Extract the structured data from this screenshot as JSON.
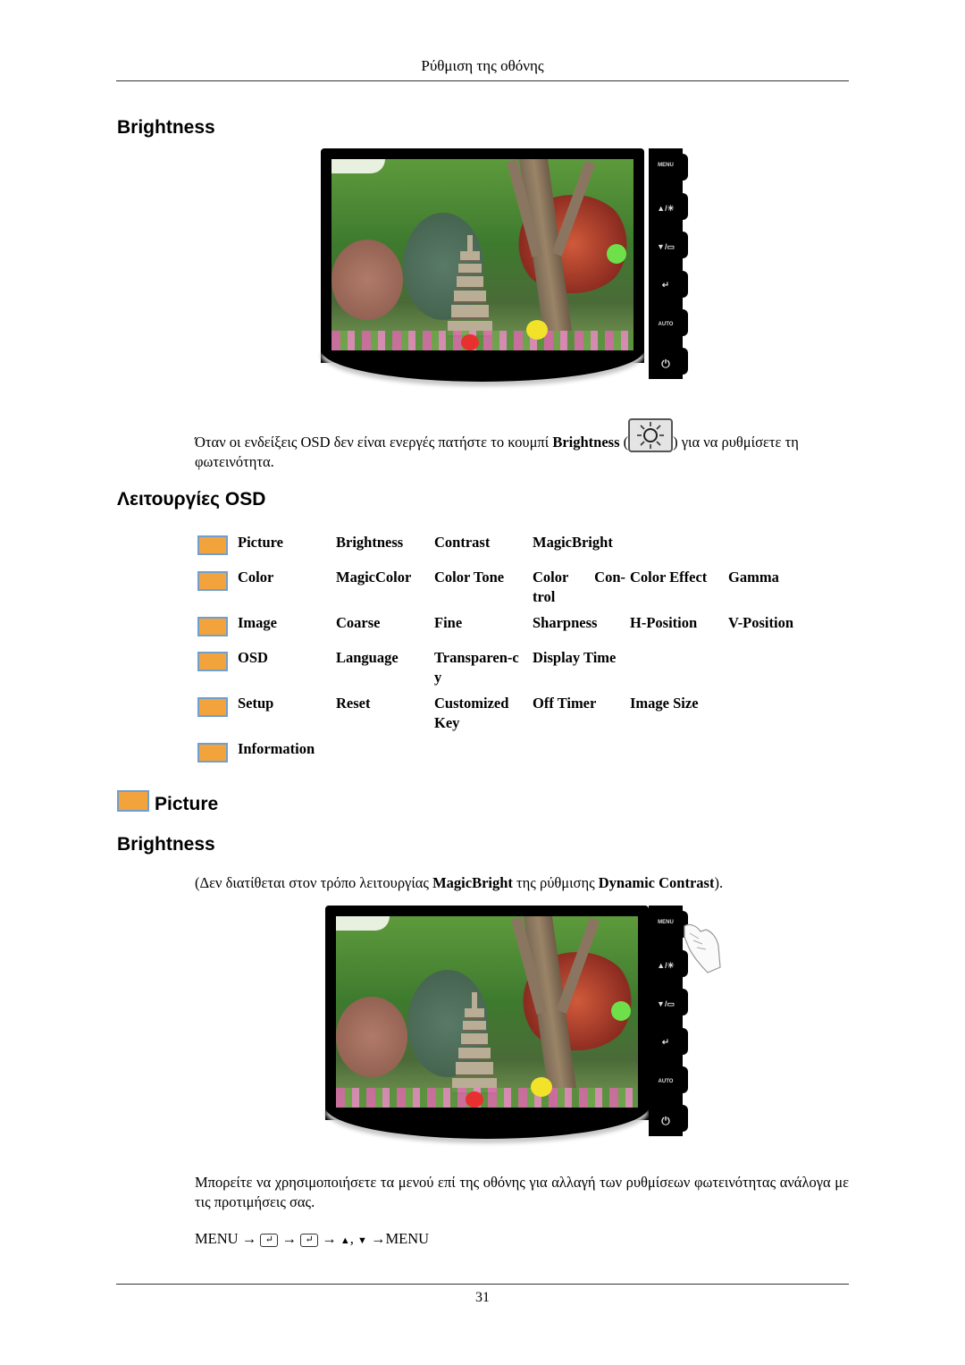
{
  "page": {
    "running_header": "Ρύθμιση της οθόνης",
    "page_number": "31"
  },
  "section1": {
    "heading": "Brightness",
    "monitor_buttons": [
      "MENU",
      "▲/☀",
      "▼/▭",
      "↵",
      "AUTO",
      "⏻"
    ],
    "paragraph_before": "Όταν οι ενδείξεις OSD δεν είναι ενεργές πατήστε το κουμπί ",
    "paragraph_bold": "Brightness",
    "paragraph_open_paren": " (",
    "paragraph_after": ") για να ρυθμίσετε τη φωτεινότητα.",
    "brightness_button_icon": "sun-icon"
  },
  "osd_section": {
    "heading": "Λειτουργίες OSD",
    "rows": [
      {
        "icon": "picture-icon",
        "cells": [
          "Picture",
          "Brightness",
          "Contrast",
          "MagicBright",
          "",
          ""
        ]
      },
      {
        "icon": "color-icon",
        "cells": [
          "Color",
          "MagicColor",
          "Color Tone",
          "Color Con-trol",
          "Color Effect",
          "Gamma"
        ]
      },
      {
        "icon": "image-icon",
        "cells": [
          "Image",
          "Coarse",
          "Fine",
          "Sharpness",
          "H-Position",
          "V-Position"
        ]
      },
      {
        "icon": "osd-icon",
        "cells": [
          "OSD",
          "Language",
          "Transparen-cy",
          "Display Time",
          "",
          ""
        ]
      },
      {
        "icon": "setup-icon",
        "cells": [
          "Setup",
          "Reset",
          "Customized Key",
          "Off Timer",
          "Image Size",
          ""
        ]
      },
      {
        "icon": "information-icon",
        "cells": [
          "Information",
          "",
          "",
          "",
          "",
          ""
        ]
      }
    ]
  },
  "picture_section": {
    "heading": "Picture",
    "subheading": "Brightness",
    "note_open": "(Δεν διατίθεται στον τρόπο λειτουργίας ",
    "note_bold1": "MagicBright",
    "note_mid": " της ρύθμισης ",
    "note_bold2": "Dynamic Contrast",
    "note_close": ").",
    "paragraph": "Μπορείτε να χρησιμοποιήσετε τα μενού επί της οθόνης για αλλαγή των ρυθμίσεων φωτεινότητας ανάλογα με τις προτιμήσεις σας.",
    "sequence": {
      "start": "MENU",
      "arrow": "→",
      "enter_glyph": "↵",
      "up": "▲",
      "sep": ",",
      "down": "▼",
      "end": "MENU"
    }
  }
}
